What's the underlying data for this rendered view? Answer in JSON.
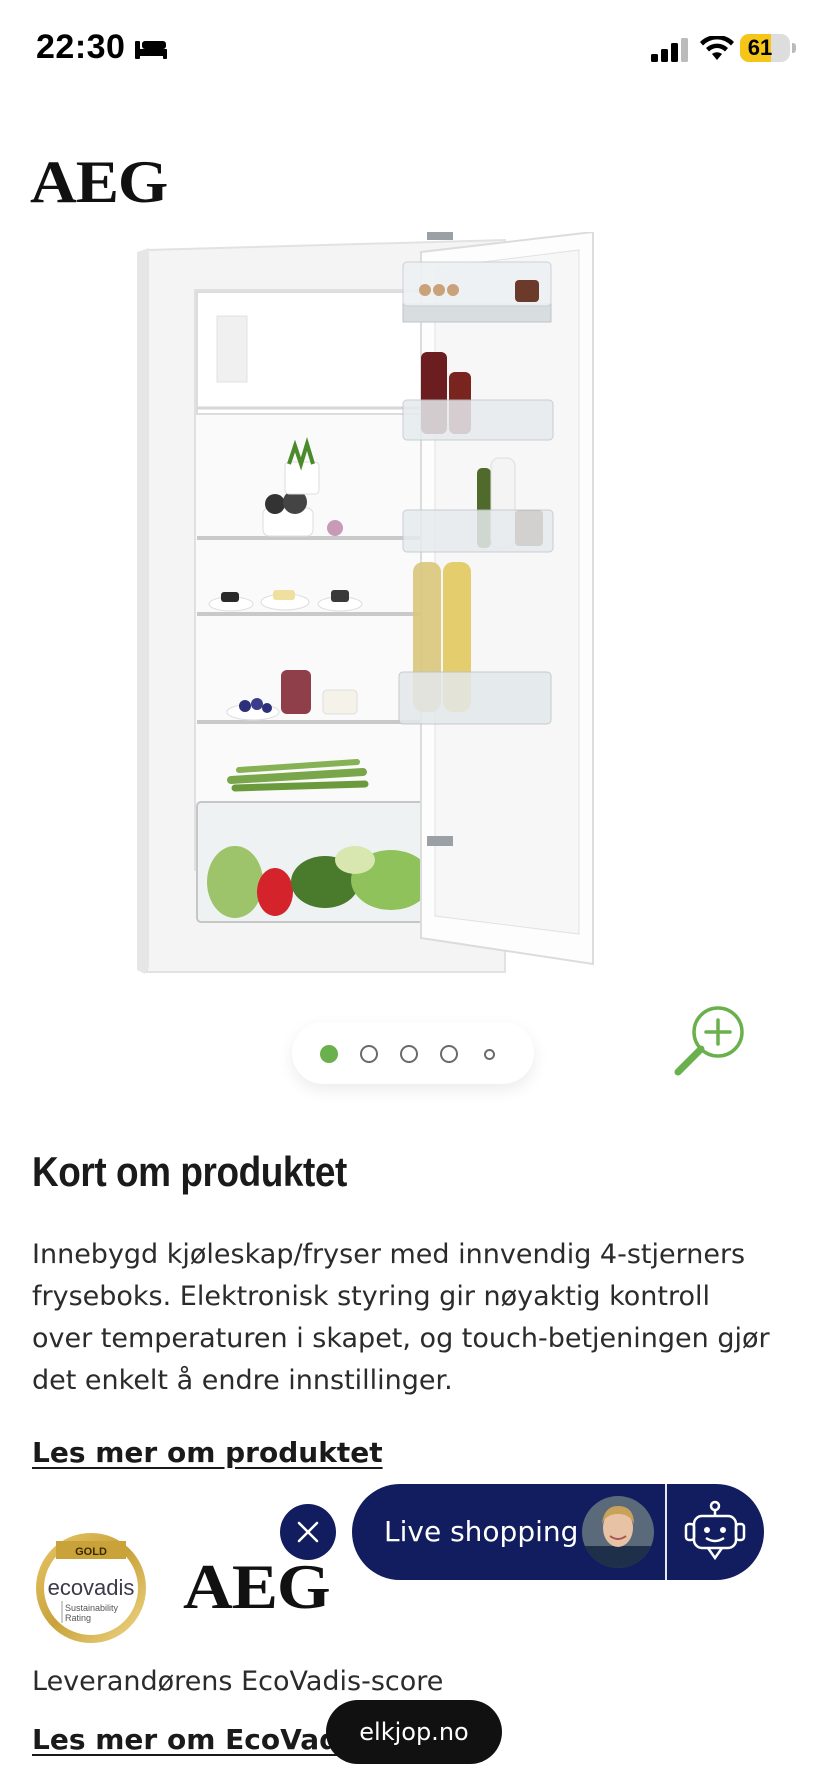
{
  "status_bar": {
    "time": "22:30",
    "battery_level": "61",
    "battery_fraction": 0.61,
    "icons": [
      "bed-icon",
      "signal-icon",
      "wifi-icon",
      "battery-icon"
    ]
  },
  "brand": {
    "name": "AEG"
  },
  "product": {
    "image_alt": "AEG innebygd kjøleskap med fryseboks",
    "carousel": {
      "total": 5,
      "active": 0
    },
    "zoom_icon": "zoom-in-icon"
  },
  "section": {
    "title": "Kort om produktet",
    "description": "Innebygd kjøleskap/fryser med innvendig 4-stjerners fryseboks. Elektronisk styring gir nøyaktig kontroll over temperaturen i skapet, og touch-betjeningen gjør det enkelt å endre innstillinger.",
    "read_more": "Les mer om produktet"
  },
  "ecovadis": {
    "badge_medal": "GOLD",
    "badge_brand": "ecovadis",
    "badge_sub1": "Sustainability",
    "badge_sub2": "Rating",
    "supplier_brand": "AEG",
    "label": "Leverandørens EcoVadis-score",
    "link": "Les mer om EcoVadis"
  },
  "live_shopping": {
    "label": "Live shopping",
    "close_icon": "close-icon",
    "bot_icon": "chatbot-icon"
  },
  "browser": {
    "url": "elkjop.no"
  },
  "colors": {
    "navy": "#111d5e",
    "accent_green": "#6ab04c",
    "battery_yellow": "#f5c518"
  }
}
